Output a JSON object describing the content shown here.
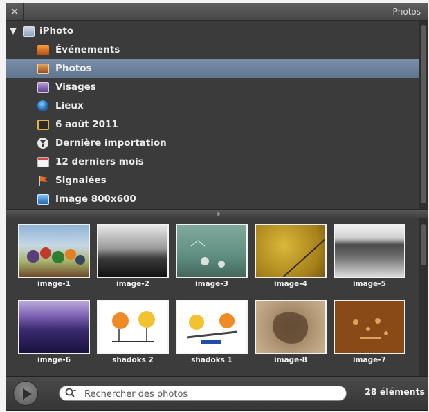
{
  "window": {
    "title": "Photos",
    "close_glyph": "✕"
  },
  "source_list": {
    "root": {
      "label": "iPhoto",
      "icon": "iphoto-icon"
    },
    "items": [
      {
        "label": "Événements",
        "icon": "events-icon"
      },
      {
        "label": "Photos",
        "icon": "photos-icon",
        "selected": true
      },
      {
        "label": "Visages",
        "icon": "faces-icon"
      },
      {
        "label": "Lieux",
        "icon": "places-globe-icon"
      },
      {
        "label": "6 août 2011",
        "icon": "event-icon"
      },
      {
        "label": "Dernière importation",
        "icon": "last-import-icon"
      },
      {
        "label": "12 derniers mois",
        "icon": "calendar-icon"
      },
      {
        "label": "Signalées",
        "icon": "flag-icon"
      },
      {
        "label": "Image 800x600",
        "icon": "album-icon"
      }
    ]
  },
  "photos": [
    {
      "caption": "image-1"
    },
    {
      "caption": "image-2"
    },
    {
      "caption": "image-3"
    },
    {
      "caption": "image-4"
    },
    {
      "caption": "image-5"
    },
    {
      "caption": "image-6"
    },
    {
      "caption": "shadoks 2"
    },
    {
      "caption": "shadoks 1"
    },
    {
      "caption": "image-8"
    },
    {
      "caption": "image-7"
    }
  ],
  "bottom_bar": {
    "search_placeholder": "Rechercher des photos",
    "count_label": "28 éléments"
  },
  "colors": {
    "selection": "#6b819b",
    "panel": "#3e3e3e"
  }
}
